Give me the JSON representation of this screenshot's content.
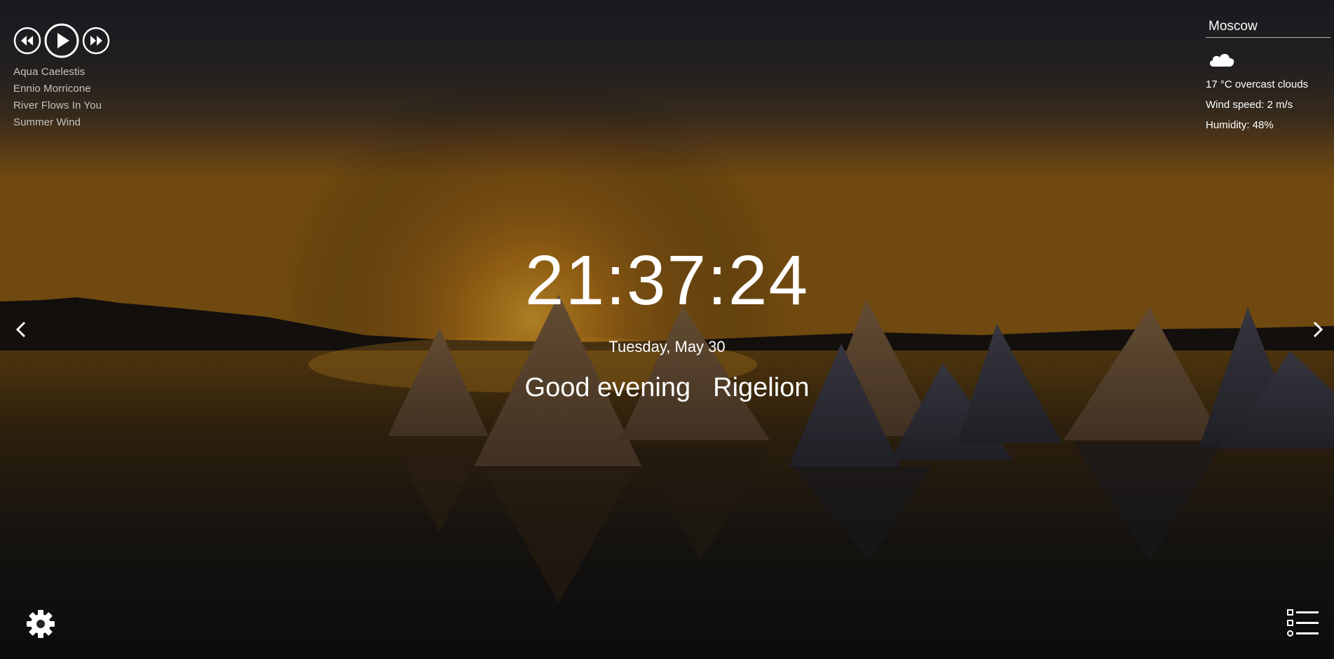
{
  "player": {
    "icons": [
      "rewind-icon",
      "play-icon",
      "fast-forward-icon"
    ],
    "playlist": [
      "Aqua Caelestis",
      "Ennio Morricone",
      "River Flows In You",
      "Summer Wind"
    ]
  },
  "weather": {
    "city": "Moscow",
    "icon": "cloud-icon",
    "description": "17 °C overcast clouds",
    "wind": "Wind speed: 2 m/s",
    "humidity": "Humidity: 48%"
  },
  "clock": {
    "time": "21:37:24",
    "date": "Tuesday, May 30"
  },
  "greeting": {
    "text": "Good evening",
    "name": "Rigelion"
  },
  "navigation": {
    "prev_icon": "chevron-left-icon",
    "next_icon": "chevron-right-icon"
  },
  "footer": {
    "settings_icon": "gear-icon",
    "todo_icon": "todo-list-icon"
  },
  "colors": {
    "text": "#ffffff",
    "muted_text": "#c8c2bb",
    "sky_top": "#2a2a33",
    "sun_glow": "#e59a20",
    "water": "#2a1e0e"
  }
}
